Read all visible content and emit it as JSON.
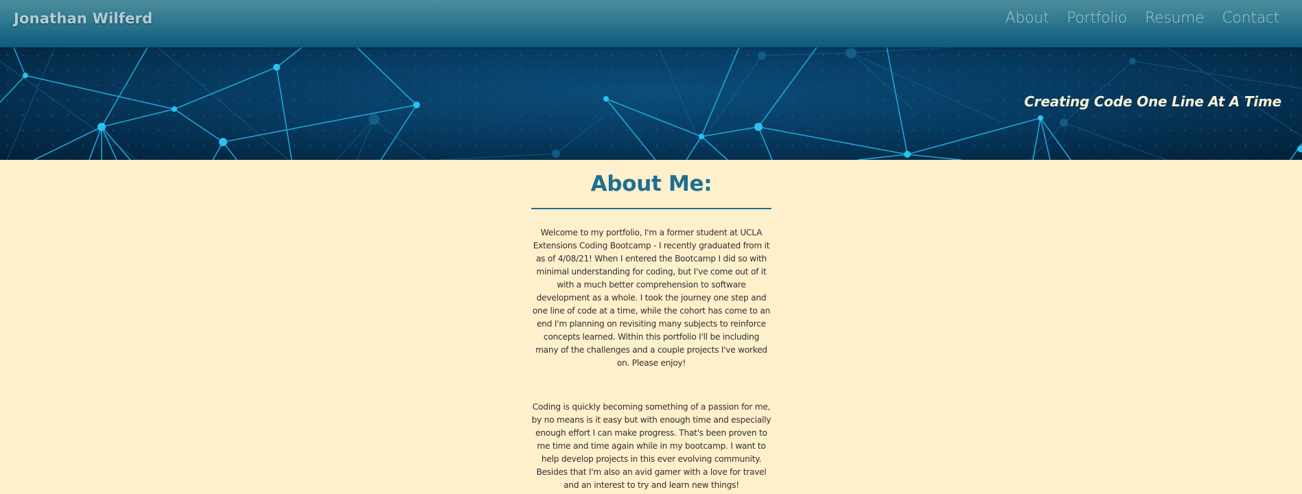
{
  "navbar": {
    "brand": "Jonathan Wilferd",
    "links": [
      {
        "label": "About"
      },
      {
        "label": "Portfolio"
      },
      {
        "label": "Resume"
      },
      {
        "label": "Contact"
      }
    ]
  },
  "hero": {
    "tagline": "Creating Code One Line At A Time"
  },
  "about": {
    "heading": "About Me:",
    "paragraphs": [
      "Welcome to my portfolio, I'm a former student at UCLA Extensions Coding Bootcamp - I recently graduated from it as of 4/08/21! When I entered the Bootcamp I did so with minimal understanding for coding, but I've come out of it with a much better comprehension to software development as a whole. I took the journey one step and one line of code at a time, while the cohort has come to an end I'm planning on revisiting many subjects to reinforce concepts learned. Within this portfolio I'll be including many of the challenges and a couple projects I've worked on. Please enjoy!",
      "Coding is quickly becoming something of a passion for me, by no means is it easy but with enough time and especially enough effort I can make progress. That's been proven to me time and time again while in my bootcamp. I want to help develop projects in this ever evolving community. Besides that I'm also an avid gamer with a love for travel and an interest to try and learn new things!"
    ]
  },
  "colors": {
    "navbar": "#2f7890",
    "hero_background": "#073c63",
    "network_lines": "#1ea7d8",
    "page_background": "#fff0cc",
    "heading": "#1e6f94",
    "tagline": "#fbf1d6"
  }
}
